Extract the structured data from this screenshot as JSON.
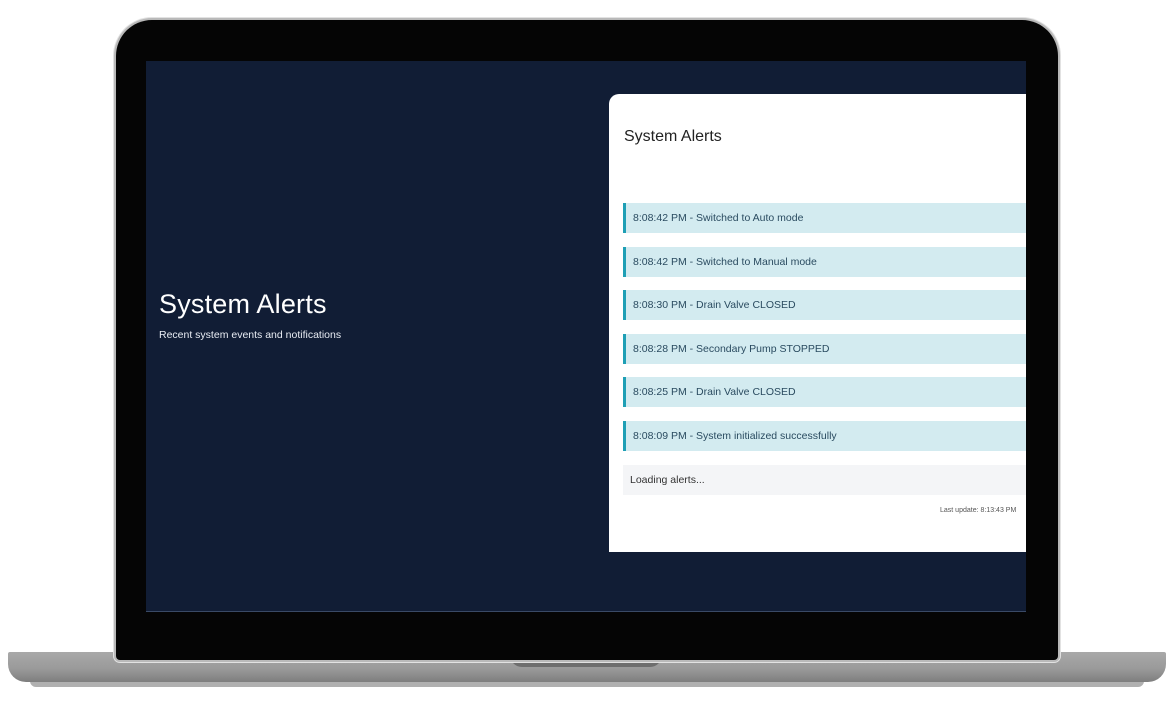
{
  "intro": {
    "title": "System Alerts",
    "subtitle": "Recent system events and notifications"
  },
  "panel": {
    "title": "System Alerts",
    "alerts": [
      "8:08:42 PM - Switched to Auto mode",
      "8:08:42 PM - Switched to Manual mode",
      "8:08:30 PM - Drain Valve CLOSED",
      "8:08:28 PM - Secondary Pump STOPPED",
      "8:08:25 PM - Drain Valve CLOSED",
      "8:08:09 PM - System initialized successfully"
    ],
    "loading_text": "Loading alerts...",
    "last_update": "Last update: 8:13:43 PM"
  },
  "colors": {
    "screen_background": "#111d35",
    "alert_background": "#d3ebf0",
    "alert_accent": "#1e9fb5"
  }
}
